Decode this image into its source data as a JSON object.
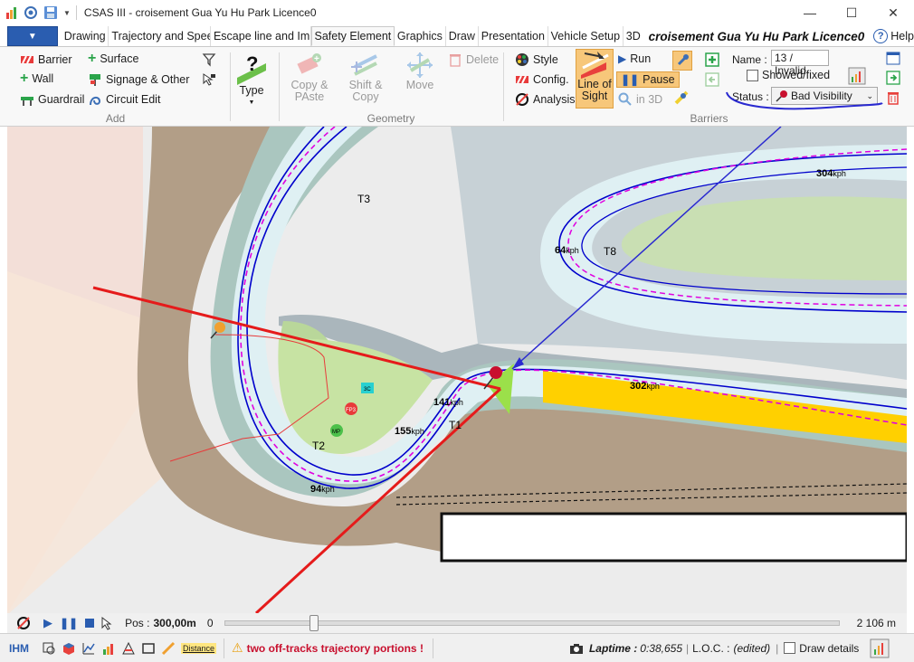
{
  "window": {
    "title": "CSAS III - croisement Gua Yu Hu Park Licence0",
    "minimize": "—",
    "maximize": "☐",
    "close": "✕"
  },
  "tabs": {
    "file_label": "▼",
    "items": [
      "Drawing",
      "Trajectory and Spee",
      "Escape line and Imp",
      "Safety Element",
      "Graphics",
      "Draw",
      "Presentation",
      "Vehicle Setup",
      "3D"
    ],
    "active_index": 3,
    "doc_title": "croisement Gua Yu Hu Park Licence0",
    "help": "Help"
  },
  "ribbon": {
    "add": {
      "label": "Add",
      "barrier": "Barrier",
      "surface": "Surface",
      "wall": "Wall",
      "signage": "Signage & Other",
      "guardrail": "Guardrail",
      "circuit_edit": "Circuit Edit"
    },
    "type": {
      "label": "Type"
    },
    "geometry": {
      "label": "Geometry",
      "copy_paste_1": "Copy &",
      "copy_paste_2": "PAste",
      "shift_copy_1": "Shift &",
      "shift_copy_2": "Copy",
      "move": "Move",
      "delete": "Delete"
    },
    "barriers": {
      "label": "Barriers",
      "style": "Style",
      "config": "Config.",
      "analysis": "Analysis",
      "line_of_sight_1": "Line of",
      "line_of_sight_2": "Sight",
      "run": "Run",
      "pause": "Pause",
      "in3d": "in 3D",
      "name_label": "Name :",
      "name_value": "13 / Invalid",
      "showed_fixed": "Showed/fixed",
      "status_label": "Status :",
      "status_value": "Bad Visibility"
    }
  },
  "map": {
    "labels": {
      "t3": "T3",
      "t8": "T8",
      "t2": "T2",
      "t1": "T1",
      "s304": "304",
      "s64": "64",
      "s302": "302",
      "s141": "141",
      "s155": "155",
      "s94": "94",
      "kph": "kph",
      "marker_3c": "3C",
      "marker_fp": "FP3",
      "marker_mp": "MP"
    },
    "colors": {
      "track": "#d9ecef",
      "runoff": "#aac6bf",
      "gravel": "#b29e87",
      "grass": "#c9dfb3",
      "trajectory": "#0000cc",
      "dashed": "#e000e0",
      "sightline": "#e51b1b",
      "sightcone": "#9be04a",
      "barrier_yellow": "#ffd000"
    }
  },
  "playbar": {
    "pos_label": "Pos :",
    "pos_value": "300,00m",
    "start": "0",
    "slider_value": 0.14,
    "end": "2 106 m"
  },
  "statusbar": {
    "ihm": "IHM",
    "distance": "Distance",
    "warning": "two off-tracks trajectory portions !",
    "laptime_label": "Laptime :",
    "laptime_value": "0:38,655",
    "loc_label": "L.O.C. :",
    "loc_value": "(edited)",
    "draw_details": "Draw details"
  }
}
